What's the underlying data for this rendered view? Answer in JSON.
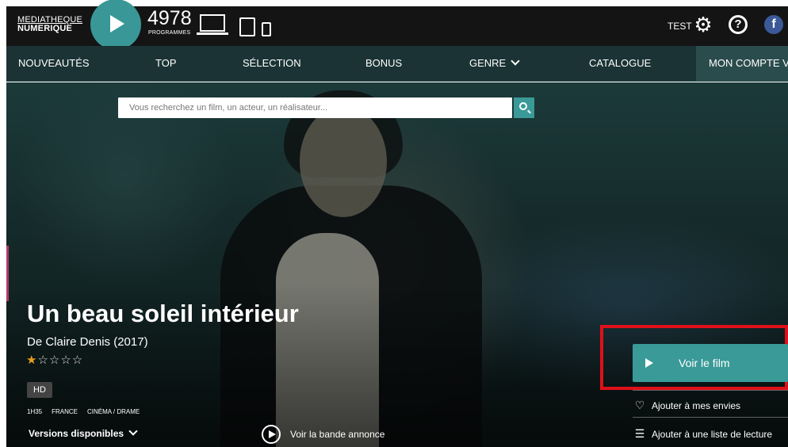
{
  "header": {
    "logo_line1": "MEDIATHEQUE",
    "logo_line2": "NUMERIQUE",
    "program_count": "4978",
    "program_label": "PROGRAMMES",
    "user_label": "TEST",
    "icons": [
      "play-icon",
      "laptop-icon",
      "tablet-icon",
      "phone-icon",
      "gear-icon",
      "help-icon",
      "facebook-icon"
    ],
    "fb_glyph": "f",
    "help_glyph": "?"
  },
  "nav": {
    "items": [
      {
        "label": "NOUVEAUTÉS"
      },
      {
        "label": "TOP"
      },
      {
        "label": "SÉLECTION"
      },
      {
        "label": "BONUS"
      },
      {
        "label": "GENRE"
      },
      {
        "label": "CATALOGUE"
      },
      {
        "label": "MON COMPTE VO"
      }
    ]
  },
  "search": {
    "placeholder": "Vous recherchez un film, un acteur, un réalisateur..."
  },
  "film": {
    "title": "Un beau soleil intérieur",
    "director_line": "De Claire Denis (2017)",
    "rating": 1,
    "rating_max": 5,
    "stars_on": "★",
    "stars_off": "☆☆☆☆",
    "quality_badge": "HD",
    "duration": "1H35",
    "country": "FRANCE",
    "genre": "CINÉMA / DRAME",
    "versions_label": "Versions disponibles",
    "trailer_label": "Voir la bande annonce"
  },
  "actions": {
    "watch_label": "Voir le film",
    "wishlist_label": "Ajouter à mes envies",
    "playlist_label": "Ajouter à une liste de lecture"
  },
  "colors": {
    "accent": "#3a9a98",
    "topbar": "#141414",
    "navbar": "#1b3334",
    "highlight": "#e0101a",
    "star": "#e8a21a"
  }
}
